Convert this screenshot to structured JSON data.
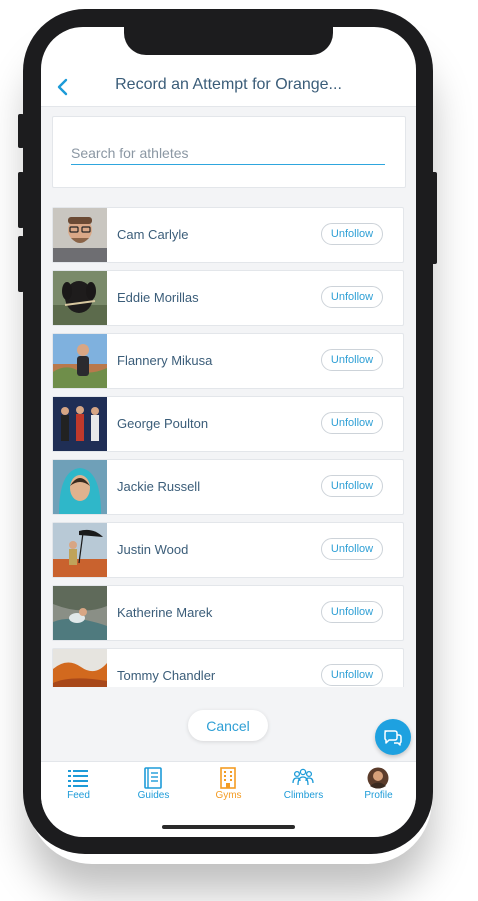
{
  "header": {
    "title": "Record an Attempt for Orange..."
  },
  "search": {
    "placeholder": "Search for athletes"
  },
  "athletes": [
    {
      "name": "Cam Carlyle",
      "action": "Unfollow"
    },
    {
      "name": "Eddie Morillas",
      "action": "Unfollow"
    },
    {
      "name": "Flannery Mikusa",
      "action": "Unfollow"
    },
    {
      "name": "George Poulton",
      "action": "Unfollow"
    },
    {
      "name": "Jackie Russell",
      "action": "Unfollow"
    },
    {
      "name": "Justin Wood",
      "action": "Unfollow"
    },
    {
      "name": "Katherine Marek",
      "action": "Unfollow"
    },
    {
      "name": "Tommy Chandler",
      "action": "Unfollow"
    }
  ],
  "cancel_label": "Cancel",
  "tabs": [
    {
      "label": "Feed",
      "icon": "list-icon",
      "color": "#1d9bd8"
    },
    {
      "label": "Guides",
      "icon": "book-icon",
      "color": "#1d9bd8"
    },
    {
      "label": "Gyms",
      "icon": "building-icon",
      "color": "#f39c24"
    },
    {
      "label": "Climbers",
      "icon": "people-icon",
      "color": "#1d9bd8"
    },
    {
      "label": "Profile",
      "icon": "avatar-icon",
      "color": "#1d9bd8"
    }
  ],
  "colors": {
    "accent": "#1d9bd8",
    "active_tab": "#f39c24",
    "title": "#3b5d79"
  }
}
